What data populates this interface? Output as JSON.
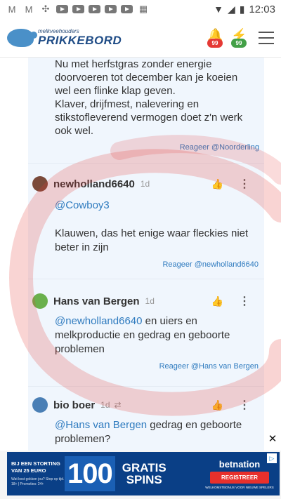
{
  "statusbar": {
    "time": "12:03",
    "icons": [
      "gmail-icon",
      "gmail-icon",
      "pinwheel-icon",
      "youtube-icon",
      "youtube-icon",
      "youtube-icon",
      "youtube-icon",
      "youtube-icon",
      "calendar-icon"
    ]
  },
  "app": {
    "logo_small": "melkveehouders",
    "logo_big": "PRIKKEBORD",
    "badge_one_count": "99",
    "badge_two_count": "99",
    "badge_one_color": "#e53935",
    "badge_two_color": "#43a047"
  },
  "first_comment": {
    "lines": [
      "Nu met herfstgras zonder energie",
      "doorvoeren tot december kan je koeien",
      "wel een flinke klap geven.",
      "Klaver, drijfmest, nalevering en",
      "stikstofleverend vermogen doet z'n werk",
      "ook wel."
    ],
    "reply": "Reageer @Noorderling"
  },
  "comments": [
    {
      "author": "newholland6640",
      "time": "1d",
      "mention": "@Cowboy3",
      "text": "Klauwen, das het enige waar fleckies niet beter in zijn",
      "reply": "Reageer @newholland6640"
    },
    {
      "author": "Hans van Bergen",
      "time": "1d",
      "mention": "@newholland6640",
      "text": " en uiers en melkproductie en gedrag en geboorte problemen",
      "reply": "Reageer @Hans van Bergen"
    },
    {
      "author": "bio boer",
      "time": "1d",
      "mention": "@Hans van Bergen",
      "text": " gedrag en geboorte problemen?"
    }
  ],
  "ad": {
    "left_title": "BIJ EEN STORTING VAN 25 EURO",
    "left_fine": "Wat kost gokken jou? Stop op tijd. 18+ | Promoties: 24+",
    "number": "100",
    "spins_line1": "GRATIS",
    "spins_line2": "SPINS",
    "brand": "betnation",
    "cta": "REGISTREER",
    "fine": "WELKOMSTBONUS VOOR NIEUWE SPELERS",
    "close": "✕"
  },
  "colors": {
    "accent": "#2f7bbf",
    "thread_bg": "#f0f6fd",
    "overlay": "#e53935"
  }
}
